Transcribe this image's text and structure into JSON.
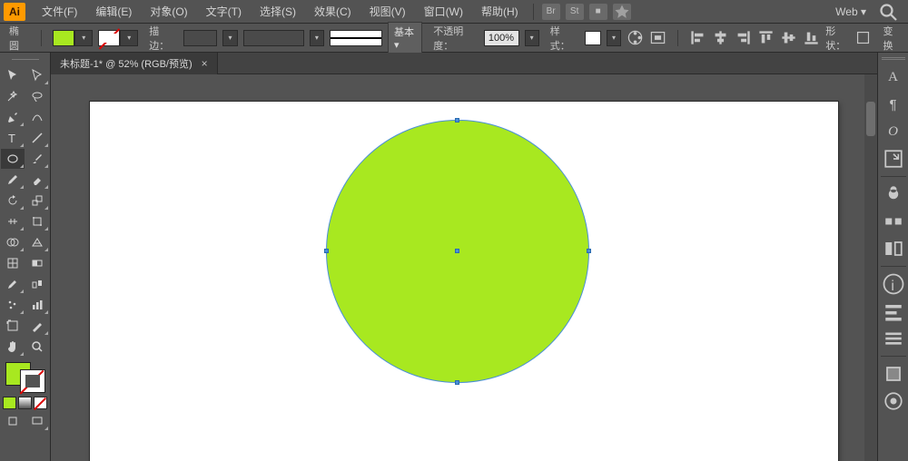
{
  "app": {
    "logo_text": "Ai"
  },
  "menu": {
    "items": [
      {
        "label": "文件(F)"
      },
      {
        "label": "编辑(E)"
      },
      {
        "label": "对象(O)"
      },
      {
        "label": "文字(T)"
      },
      {
        "label": "选择(S)"
      },
      {
        "label": "效果(C)"
      },
      {
        "label": "视图(V)"
      },
      {
        "label": "窗口(W)"
      },
      {
        "label": "帮助(H)"
      }
    ],
    "mini_icons": [
      "Br",
      "St",
      "■"
    ],
    "workspace_label": "Web"
  },
  "options": {
    "tool_label": "椭圆",
    "fill_color": "#a8e820",
    "stroke_label": "描边：",
    "stroke_style_label": "基本",
    "opacity_label": "不透明度：",
    "opacity_value": "100%",
    "style_label": "样式：",
    "shape_label": "形状：",
    "transform_label": "变换"
  },
  "document": {
    "tab_title": "未标题-1* @ 52% (RGB/预览)"
  },
  "canvas": {
    "shape_fill": "#a8e820",
    "shape_stroke": "#4a8fd8"
  },
  "tools": {
    "list": [
      "selection",
      "direct-selection",
      "magic-wand",
      "lasso",
      "pen",
      "curvature",
      "type",
      "line",
      "ellipse",
      "paintbrush",
      "pencil",
      "eraser",
      "rotate",
      "scale",
      "width",
      "free-transform",
      "shape-builder",
      "perspective",
      "mesh",
      "gradient",
      "eyedropper",
      "blend",
      "symbol-sprayer",
      "column-graph",
      "artboard",
      "slice",
      "hand",
      "zoom"
    ]
  },
  "right_panels": {
    "icons": [
      "character",
      "paragraph",
      "opentype",
      "export",
      "symbols",
      "brushes",
      "librariesA",
      "info",
      "align",
      "hamburger",
      "swatch-panel",
      "actions"
    ]
  }
}
